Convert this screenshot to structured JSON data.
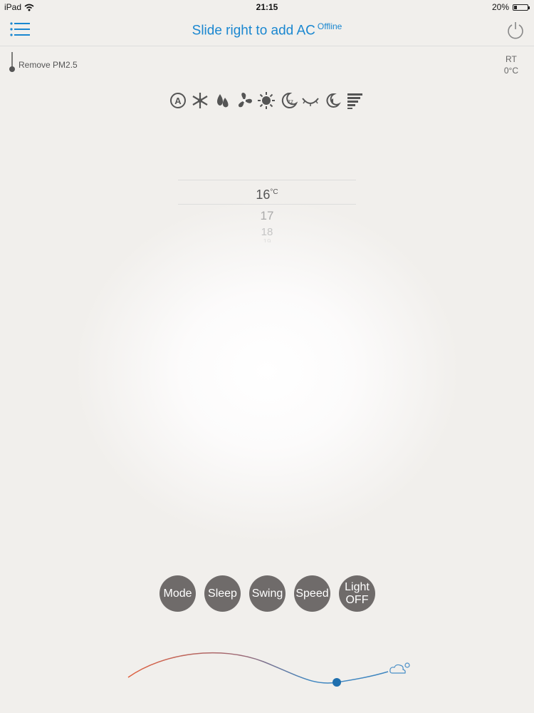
{
  "status_bar": {
    "device": "iPad",
    "time": "21:15",
    "battery": "20%",
    "battery_level": 0.2
  },
  "header": {
    "title": "Slide right to add  AC",
    "status": "Offline"
  },
  "pm": {
    "label": "Remove PM2.5"
  },
  "room_temp": {
    "label": "RT",
    "value": "0°C"
  },
  "modes": [
    "auto-mode-icon",
    "snowflake-icon",
    "drop-icon",
    "fan-icon",
    "sun-icon",
    "moon-icon",
    "eye-icon",
    "moon-half-icon",
    "speed-bars-icon"
  ],
  "temperature": {
    "selected": "16",
    "unit": "°C",
    "next1": "17",
    "next2": "18",
    "next3": "19"
  },
  "buttons": {
    "mode": "Mode",
    "sleep": "Sleep",
    "swing": "Swing",
    "speed": "Speed",
    "light_line1": "Light",
    "light_line2": "OFF"
  },
  "colors": {
    "accent": "#1a87d0",
    "button": "#6f6b6a",
    "curve_warm": "#e0603f",
    "curve_cool": "#3f86c0"
  }
}
